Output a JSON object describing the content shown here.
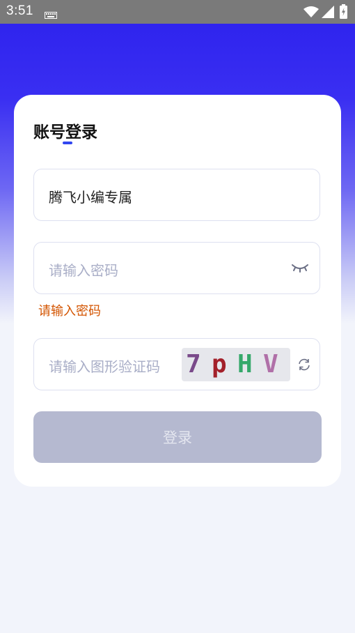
{
  "status_bar": {
    "time": "3:51"
  },
  "login": {
    "title": "账号登录",
    "username_value": "腾飞小编专属",
    "password_placeholder": "请输入密码",
    "password_error": "请输入密码",
    "captcha_placeholder": "请输入图形验证码",
    "captcha_chars": [
      "7",
      "p",
      "H",
      "V"
    ],
    "captcha_colors": [
      "#7a4a8a",
      "#a3202a",
      "#35a86a",
      "#b070a8"
    ],
    "submit_label": "登录"
  },
  "colors": {
    "accent": "#3146f0",
    "header_gradient_top": "#2f24ee",
    "error": "#d35400",
    "button_disabled": "#b5b9d0"
  }
}
